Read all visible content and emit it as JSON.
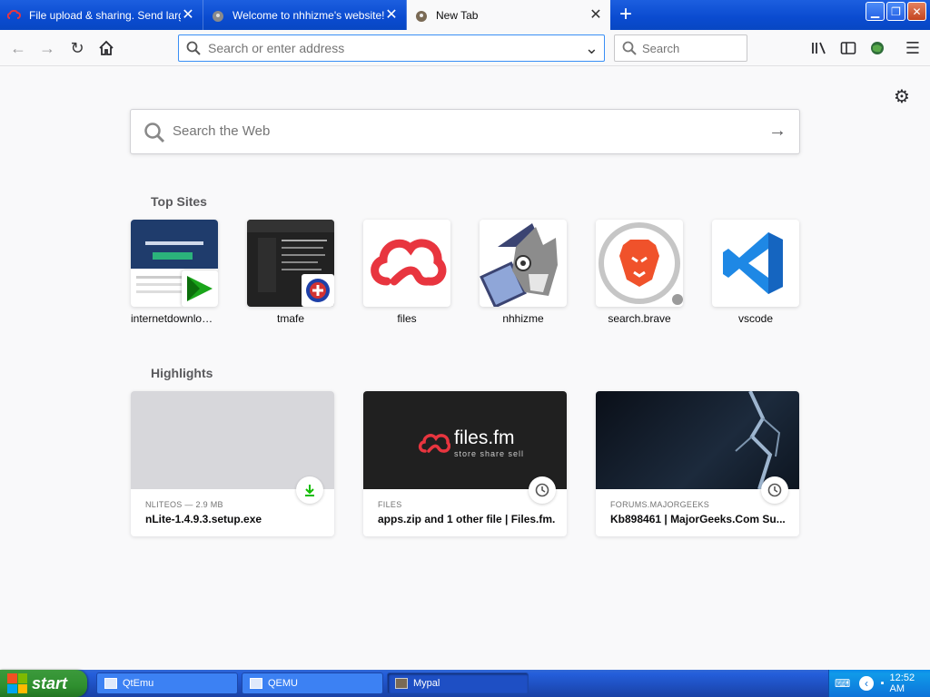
{
  "browser": {
    "tabs": [
      {
        "title": "File upload & sharing. Send large f",
        "active": false
      },
      {
        "title": "Welcome to nhhizme's website!",
        "active": false
      },
      {
        "title": "New Tab",
        "active": true
      }
    ],
    "new_tab_icon": "plus-icon",
    "address_placeholder": "Search or enter address",
    "search_placeholder": "Search"
  },
  "newtab": {
    "web_search_placeholder": "Search the Web",
    "top_sites_title": "Top Sites",
    "top_sites": [
      {
        "name": "internetdownload..."
      },
      {
        "name": "tmafe"
      },
      {
        "name": "files"
      },
      {
        "name": "nhhizme"
      },
      {
        "name": "search.brave"
      },
      {
        "name": "vscode"
      }
    ],
    "highlights_title": "Highlights",
    "highlights": [
      {
        "context": "NLITEOS — 2.9 MB",
        "title": "nLite-1.4.9.3.setup.exe",
        "badge": "download-icon"
      },
      {
        "context": "FILES",
        "title": "apps.zip and 1 other file | Files.fm.",
        "badge": "clock-icon",
        "preview_logo": "files.fm",
        "preview_tagline": "store share sell"
      },
      {
        "context": "FORUMS.MAJORGEEKS",
        "title": "Kb898461 | MajorGeeks.Com Su...",
        "badge": "clock-icon"
      }
    ]
  },
  "taskbar": {
    "start_label": "start",
    "tasks": [
      {
        "label": "QtEmu",
        "active": false
      },
      {
        "label": "QEMU",
        "active": false
      },
      {
        "label": "Mypal",
        "active": true
      }
    ],
    "clock": "12:52 AM"
  },
  "colors": {
    "accent": "#0a84ff",
    "files_red": "#e8353f",
    "brave_orange": "#f0522b",
    "vscode_blue": "#1e88e5"
  }
}
